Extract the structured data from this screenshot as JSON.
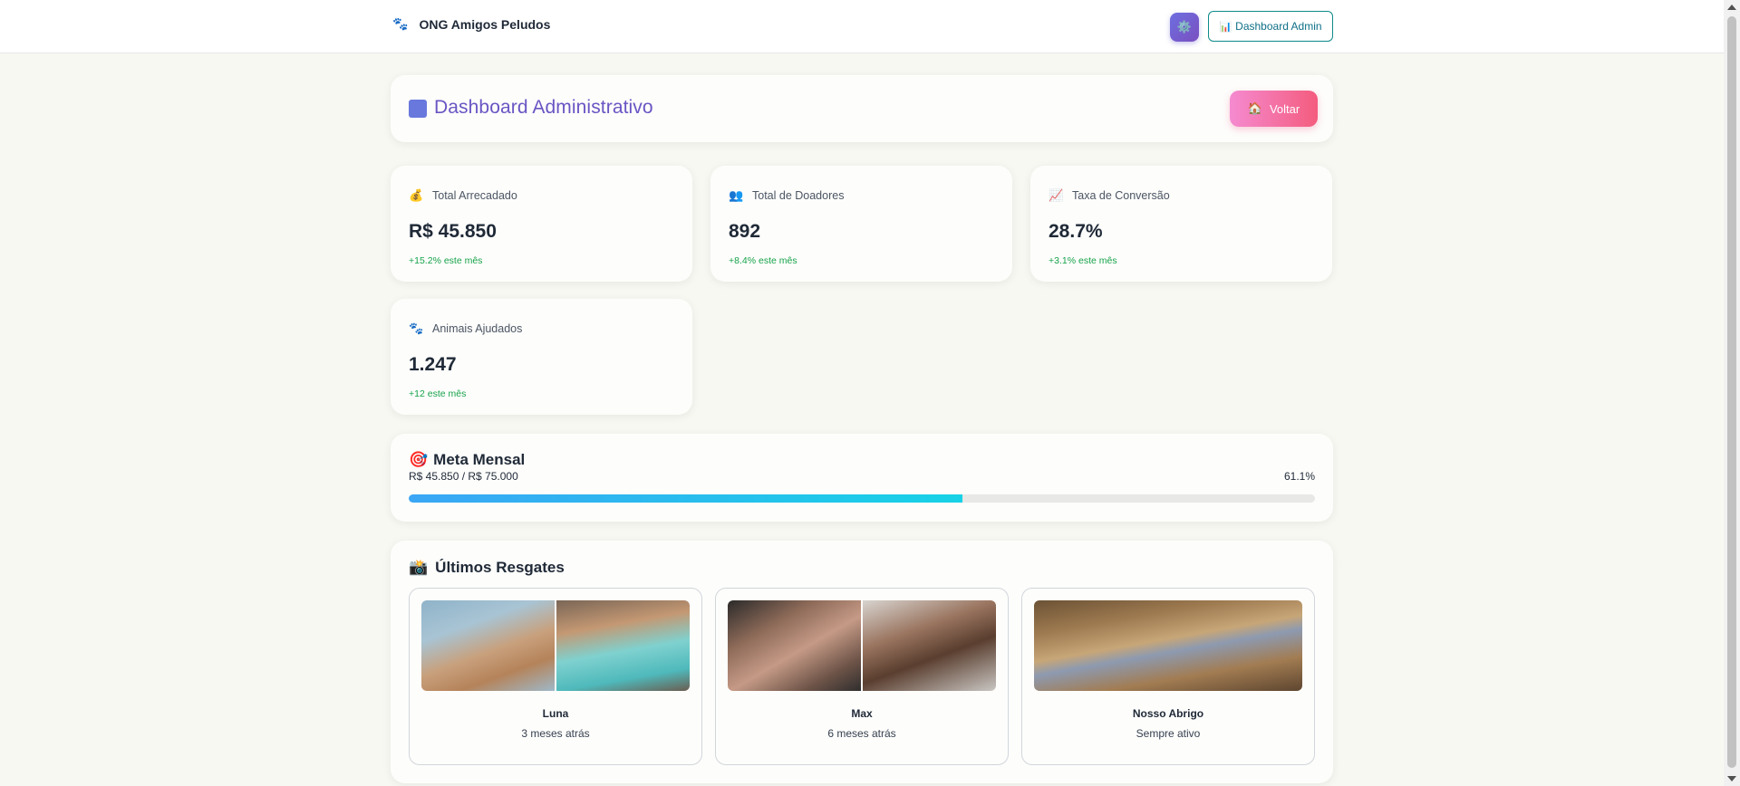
{
  "nav": {
    "brand_icon": "🐾",
    "brand_name": "ONG Amigos Peludos",
    "settings_icon": "⚙️",
    "admin_button_icon": "📊",
    "admin_button_label": "Dashboard Admin"
  },
  "header": {
    "title": "Dashboard Administrativo",
    "back_icon": "🏠",
    "back_label": "Voltar"
  },
  "stats": [
    {
      "icon": "💰",
      "label": "Total Arrecadado",
      "value": "R$ 45.850",
      "delta": "+15.2% este mês"
    },
    {
      "icon": "👥",
      "label": "Total de Doadores",
      "value": "892",
      "delta": "+8.4% este mês"
    },
    {
      "icon": "📈",
      "label": "Taxa de Conversão",
      "value": "28.7%",
      "delta": "+3.1% este mês"
    },
    {
      "icon": "🐾",
      "label": "Animais Ajudados",
      "value": "1.247",
      "delta": "+12 este mês"
    }
  ],
  "goal": {
    "icon": "🎯",
    "title": "Meta Mensal",
    "amounts": "R$ 45.850 / R$ 75.000",
    "percent_label": "61.1%",
    "progress_fraction": 0.611
  },
  "rescues": {
    "icon": "📸",
    "title": "Últimos Resgates",
    "items": [
      {
        "name": "Luna",
        "time": "3 meses atrás"
      },
      {
        "name": "Max",
        "time": "6 meses atrás"
      },
      {
        "name": "Nosso Abrigo",
        "time": "Sempre ativo"
      }
    ]
  },
  "colors": {
    "accent": "#6a55c4",
    "positive": "#16a34a",
    "progress_start": "#3aa6f5",
    "progress_end": "#17d2e6"
  }
}
